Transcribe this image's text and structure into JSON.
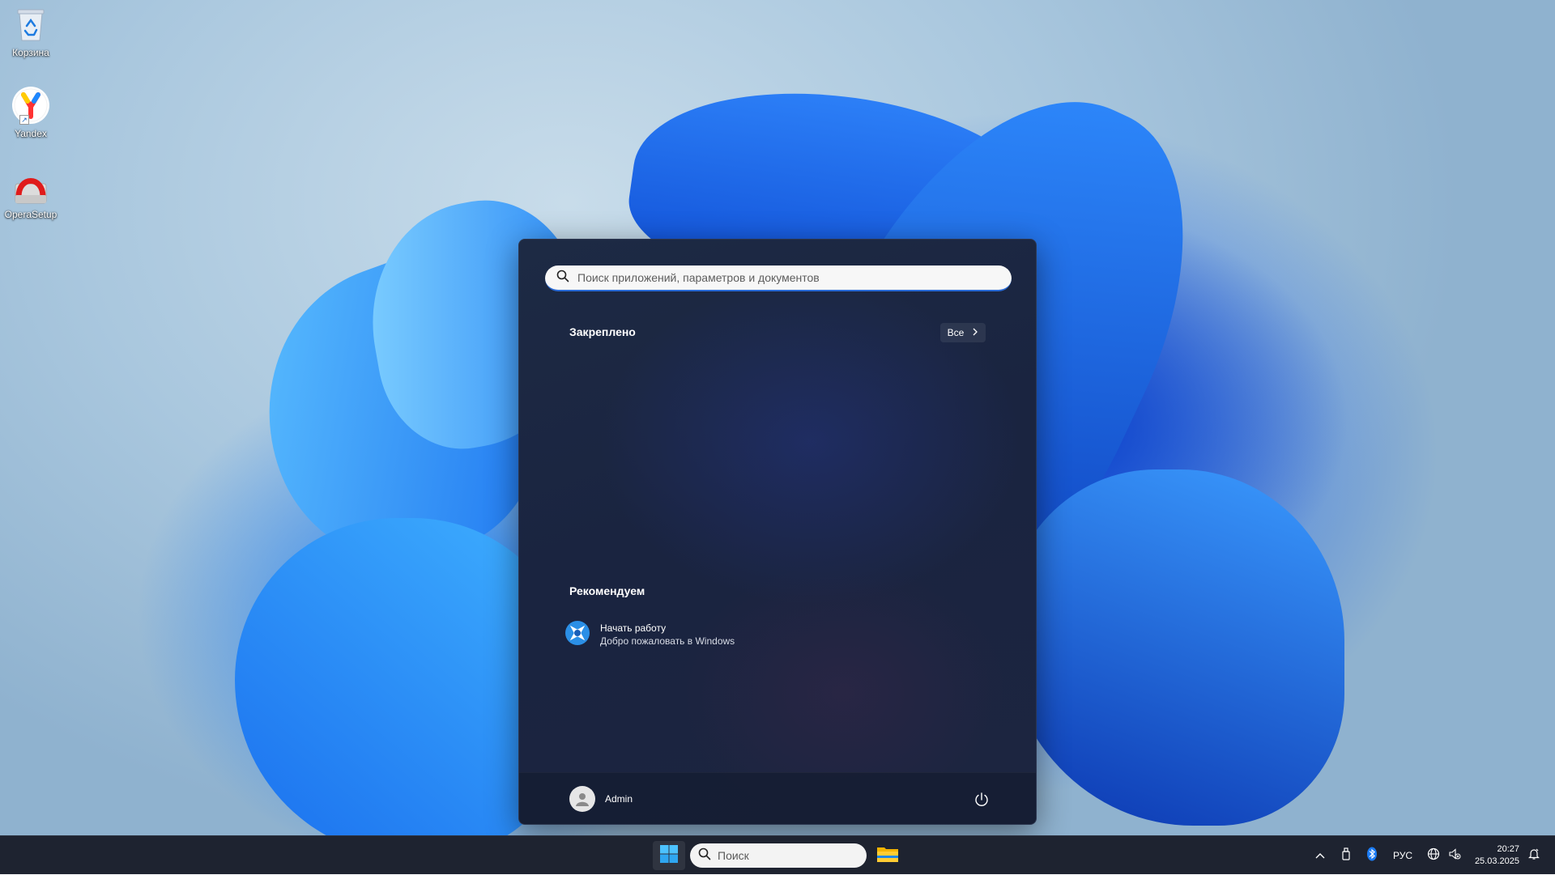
{
  "desktop": {
    "icons": [
      {
        "label": "Корзина",
        "icon": "recycle-bin-icon"
      },
      {
        "label": "Yandex",
        "icon": "yandex-browser-icon"
      },
      {
        "label": "OperaSetup",
        "icon": "opera-setup-icon"
      }
    ]
  },
  "start_menu": {
    "search_placeholder": "Поиск приложений, параметров и документов",
    "pinned_title": "Закреплено",
    "all_button": "Все",
    "recommended_title": "Рекомендуем",
    "recommended_items": [
      {
        "title": "Начать работу",
        "subtitle": "Добро пожаловать в Windows",
        "icon": "get-started-icon"
      }
    ],
    "user_name": "Admin"
  },
  "taskbar": {
    "search_placeholder": "Поиск",
    "language": "РУС",
    "time": "20:27",
    "date": "25.03.2025"
  },
  "colors": {
    "start_bg": "#1b2742",
    "taskbar_bg": "#1e2330",
    "accent": "#2a6bd6"
  }
}
